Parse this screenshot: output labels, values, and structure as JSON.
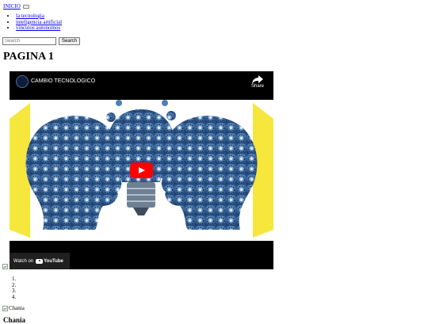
{
  "navbar": {
    "brand": "INICIO",
    "menu_items": [
      "la tecnologia",
      "inteligencia artificial",
      "vinculos autonomos"
    ]
  },
  "search": {
    "placeholder": "Search",
    "button_label": "Search"
  },
  "page": {
    "title": "PAGINA 1"
  },
  "video": {
    "title": "CAMBIO TECNOLOGICO",
    "share_label": "Share",
    "watch_on_label": "Watch on",
    "youtube_label": "YouTube"
  },
  "carousel": {
    "indicators": [
      "",
      "",
      "",
      ""
    ],
    "caption_image_alt": "Chania",
    "caption_heading": "Chania"
  },
  "colors": {
    "link": "#0000ee",
    "play_button": "#ff0000",
    "gear_blue": "#4f7fb6",
    "spotlight_yellow": "#f6e21a"
  }
}
